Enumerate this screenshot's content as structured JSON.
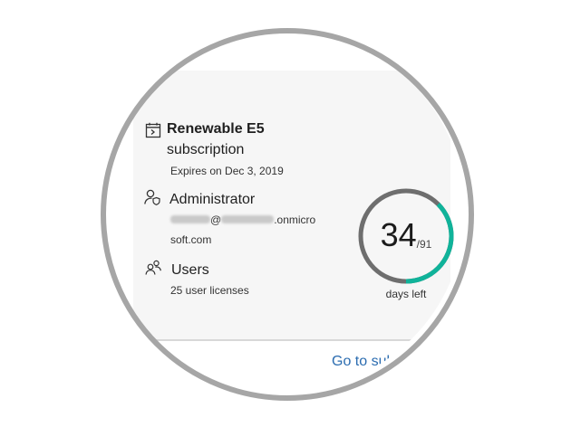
{
  "subscription": {
    "plan_title": "Renewable E5",
    "plan_subtitle": "subscription",
    "expires": "Expires on Dec 3, 2019"
  },
  "admin": {
    "label": "Administrator",
    "email_visible_at": "@",
    "email_domain_part1": ".onmicro",
    "email_domain_part2": "soft.com"
  },
  "users": {
    "label": "Users",
    "licenses": "25 user licenses"
  },
  "gauge": {
    "days_remaining": "34",
    "days_total": "/91",
    "caption": "days left",
    "progress_fraction": 0.374,
    "color_progress": "#10b39a",
    "color_track": "#6e6e6e"
  },
  "actions": {
    "go_to_subscription": "Go to subscription"
  },
  "icons": {
    "calendar": "calendar-icon",
    "admin": "admin-person-icon",
    "users": "users-icon"
  }
}
